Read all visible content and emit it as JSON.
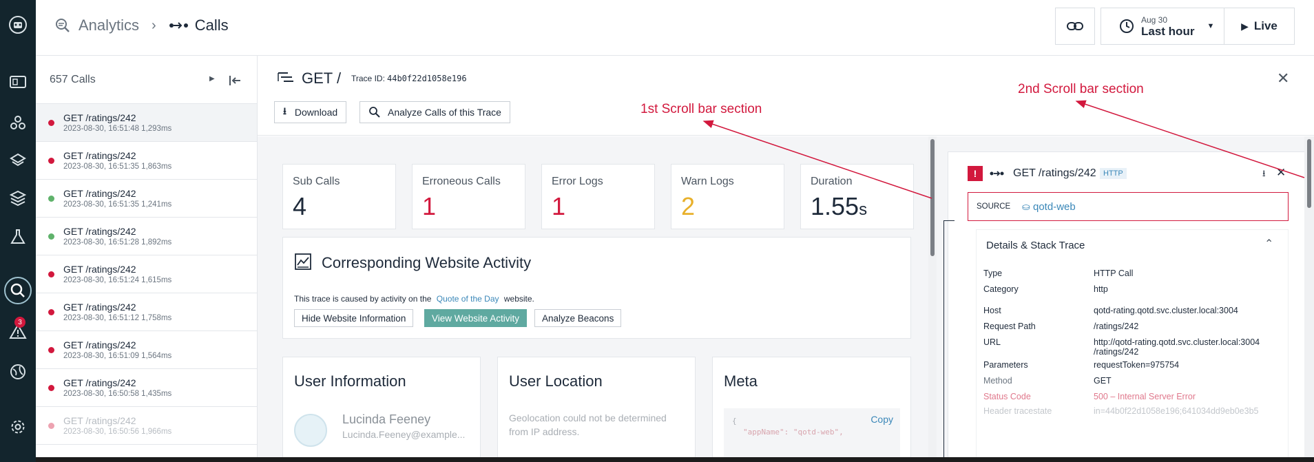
{
  "header": {
    "crumb_parent": "Analytics",
    "crumb_current": "Calls",
    "time_date": "Aug 30",
    "time_range": "Last hour",
    "live_label": "Live"
  },
  "rail": {
    "alerts_badge": "3"
  },
  "list": {
    "count_label": "657 Calls",
    "items": [
      {
        "title": "GET /ratings/242",
        "meta": "2023-08-30, 16:51:48  1,293ms",
        "status": "error"
      },
      {
        "title": "GET /ratings/242",
        "meta": "2023-08-30, 16:51:35  1,863ms",
        "status": "error"
      },
      {
        "title": "GET /ratings/242",
        "meta": "2023-08-30, 16:51:35  1,241ms",
        "status": "ok"
      },
      {
        "title": "GET /ratings/242",
        "meta": "2023-08-30, 16:51:28  1,892ms",
        "status": "ok"
      },
      {
        "title": "GET /ratings/242",
        "meta": "2023-08-30, 16:51:24  1,615ms",
        "status": "error"
      },
      {
        "title": "GET /ratings/242",
        "meta": "2023-08-30, 16:51:12  1,758ms",
        "status": "error"
      },
      {
        "title": "GET /ratings/242",
        "meta": "2023-08-30, 16:51:09  1,564ms",
        "status": "error"
      },
      {
        "title": "GET /ratings/242",
        "meta": "2023-08-30, 16:50:58  1,435ms",
        "status": "error"
      },
      {
        "title": "GET /ratings/242",
        "meta": "2023-08-30, 16:50:56  1,966ms",
        "status": "error"
      }
    ]
  },
  "trace": {
    "title": "GET /",
    "trace_id_label": "Trace ID:",
    "trace_id": "44b0f22d1058e196",
    "download_label": "Download",
    "analyze_label": "Analyze Calls of this Trace"
  },
  "stats": [
    {
      "label": "Sub Calls",
      "value": "4",
      "color": "#1e2a3a"
    },
    {
      "label": "Erroneous Calls",
      "value": "1",
      "color": "#d2183d"
    },
    {
      "label": "Error Logs",
      "value": "1",
      "color": "#d2183d"
    },
    {
      "label": "Warn Logs",
      "value": "2",
      "color": "#e8b02a"
    },
    {
      "label": "Duration",
      "value": "1.55",
      "unit": "s",
      "color": "#1e2a3a"
    }
  ],
  "website": {
    "title": "Corresponding Website Activity",
    "text_before": "This trace is caused by activity on the",
    "link": "Quote of the Day",
    "text_after": "website.",
    "hide_btn": "Hide Website Information",
    "view_btn": "View Website Activity",
    "beacons_btn": "Analyze Beacons"
  },
  "user_info": {
    "title": "User Information",
    "name": "Lucinda Feeney",
    "email": "Lucinda.Feeney@example..."
  },
  "user_location": {
    "title": "User Location",
    "text1": "Geolocation could not be determined",
    "text2": "from IP address."
  },
  "meta": {
    "title": "Meta",
    "copy": "Copy",
    "line1": "{",
    "line2": "\"appName\": \"qotd-web\","
  },
  "detail": {
    "title": "GET /ratings/242",
    "tag": "HTTP",
    "source_label": "SOURCE",
    "source_value": "qotd-web",
    "section_title": "Details & Stack Trace",
    "rows": [
      {
        "k": "Type",
        "v": "HTTP Call"
      },
      {
        "k": "Category",
        "v": "http"
      },
      {
        "k": "Host",
        "v": "qotd-rating.qotd.svc.cluster.local:3004"
      },
      {
        "k": "Request Path",
        "v": "/ratings/242"
      },
      {
        "k": "URL",
        "v": "http://qotd-rating.qotd.svc.cluster.local:3004",
        "v2": "/ratings/242"
      },
      {
        "k": "Parameters",
        "v": "requestToken=975754"
      },
      {
        "k": "Method",
        "v": "GET"
      },
      {
        "k": "Status Code",
        "v": "500 – Internal Server Error"
      },
      {
        "k": "Header tracestate",
        "v": "in=44b0f22d1058e196;641034dd9eb0e3b5"
      }
    ]
  },
  "annotations": {
    "first": "1st Scroll bar section",
    "second": "2nd Scroll bar section"
  },
  "colors": {
    "error": "#d2183d",
    "ok": "#5fb26b",
    "accent": "#5fa9a0",
    "link": "#3a87b8"
  }
}
